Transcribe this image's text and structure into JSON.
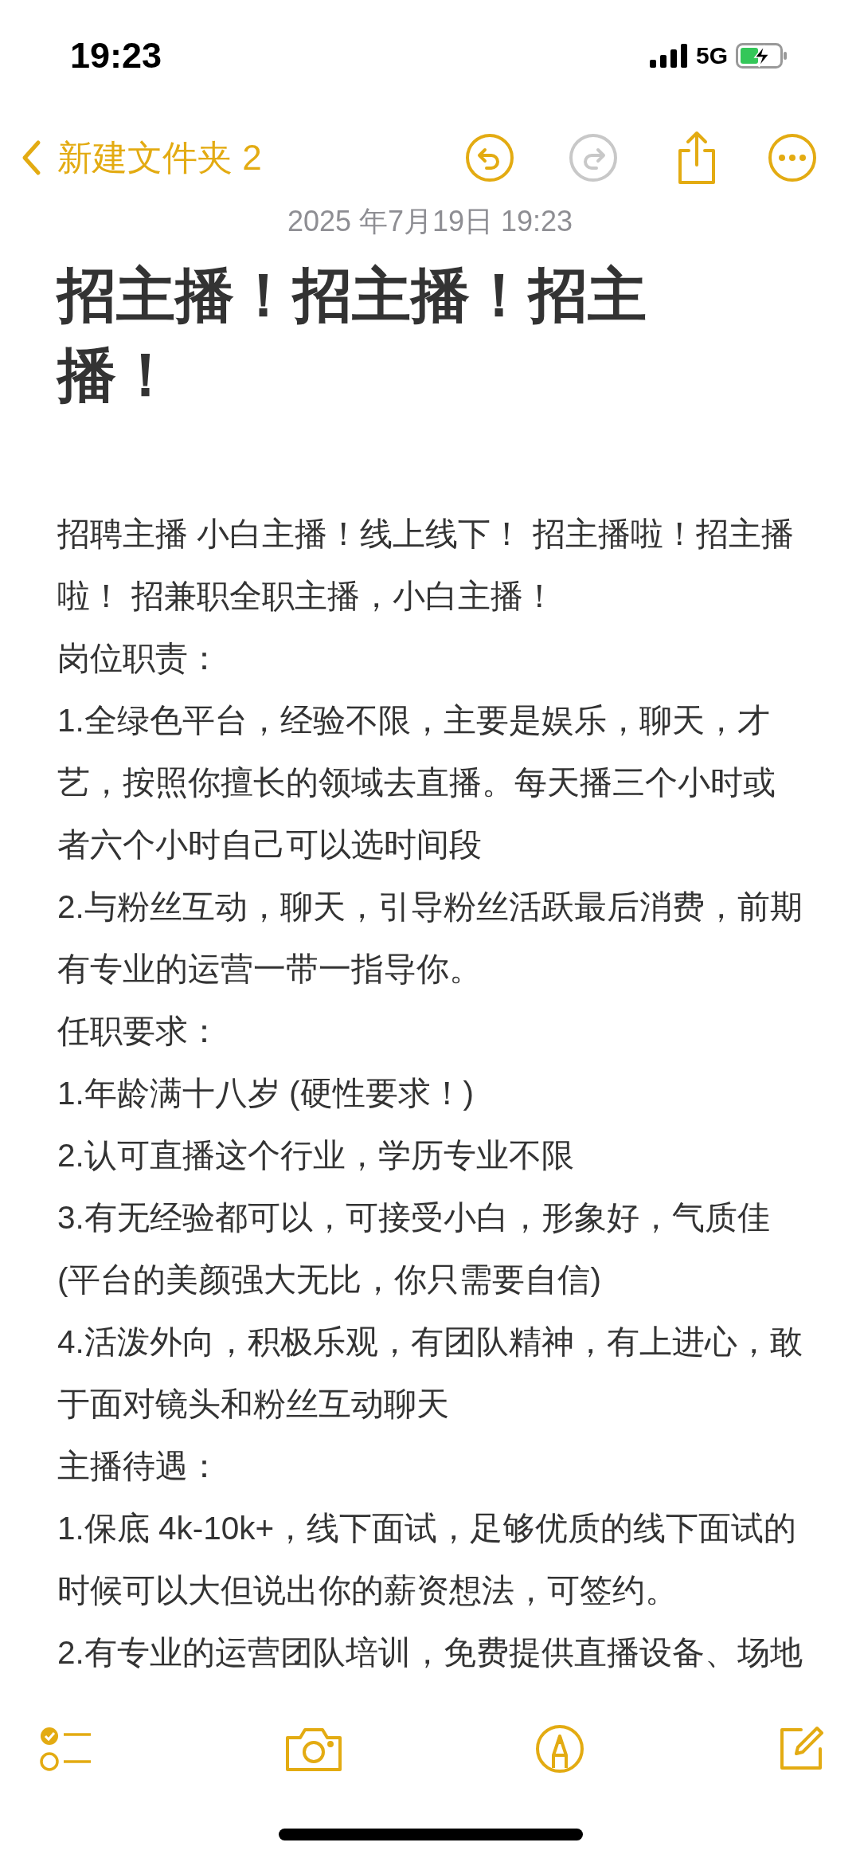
{
  "status_bar": {
    "time": "19:23",
    "network": "5G"
  },
  "nav": {
    "back_label": "新建文件夹 2",
    "actions": [
      {
        "kind": "undo",
        "disabled": false
      },
      {
        "kind": "redo",
        "disabled": true
      },
      {
        "kind": "share",
        "disabled": false
      },
      {
        "kind": "more",
        "disabled": false
      }
    ]
  },
  "note": {
    "date": "2025 年7月19日 19:23",
    "title": "招主播！招主播！招主播！",
    "paragraphs": [
      "招聘主播 小白主播！线上线下！ 招主播啦！招主播啦！ 招兼职全职主播，小白主播！",
      "岗位职责：",
      "1.全绿色平台，经验不限，主要是娱乐，聊天，才艺，按照你擅长的领域去直播。每天播三个小时或者六个小时自己可以选时间段",
      "2.与粉丝互动，聊天，引导粉丝活跃最后消费，前期有专业的运营一带一指导你。",
      "任职要求：",
      "1.年龄满十八岁 (硬性要求！)",
      "2.认可直播这个行业，学历专业不限",
      "3.有无经验都可以，可接受小白，形象好，气质佳 (平台的美颜强大无比，你只需要自信)",
      "4.活泼外向，积极乐观，有团队精神，有上进心，敢于面对镜头和粉丝互动聊天",
      "主播待遇：",
      "1.保底 4k-10k+，线下面试，足够优质的线下面试的时候可以大但说出你的薪资想法，可签约。",
      "2.有专业的运营团队培训，免费提供直播设备、场地"
    ]
  },
  "toolbar": [
    {
      "kind": "checklist"
    },
    {
      "kind": "camera"
    },
    {
      "kind": "markup"
    },
    {
      "kind": "compose"
    }
  ]
}
